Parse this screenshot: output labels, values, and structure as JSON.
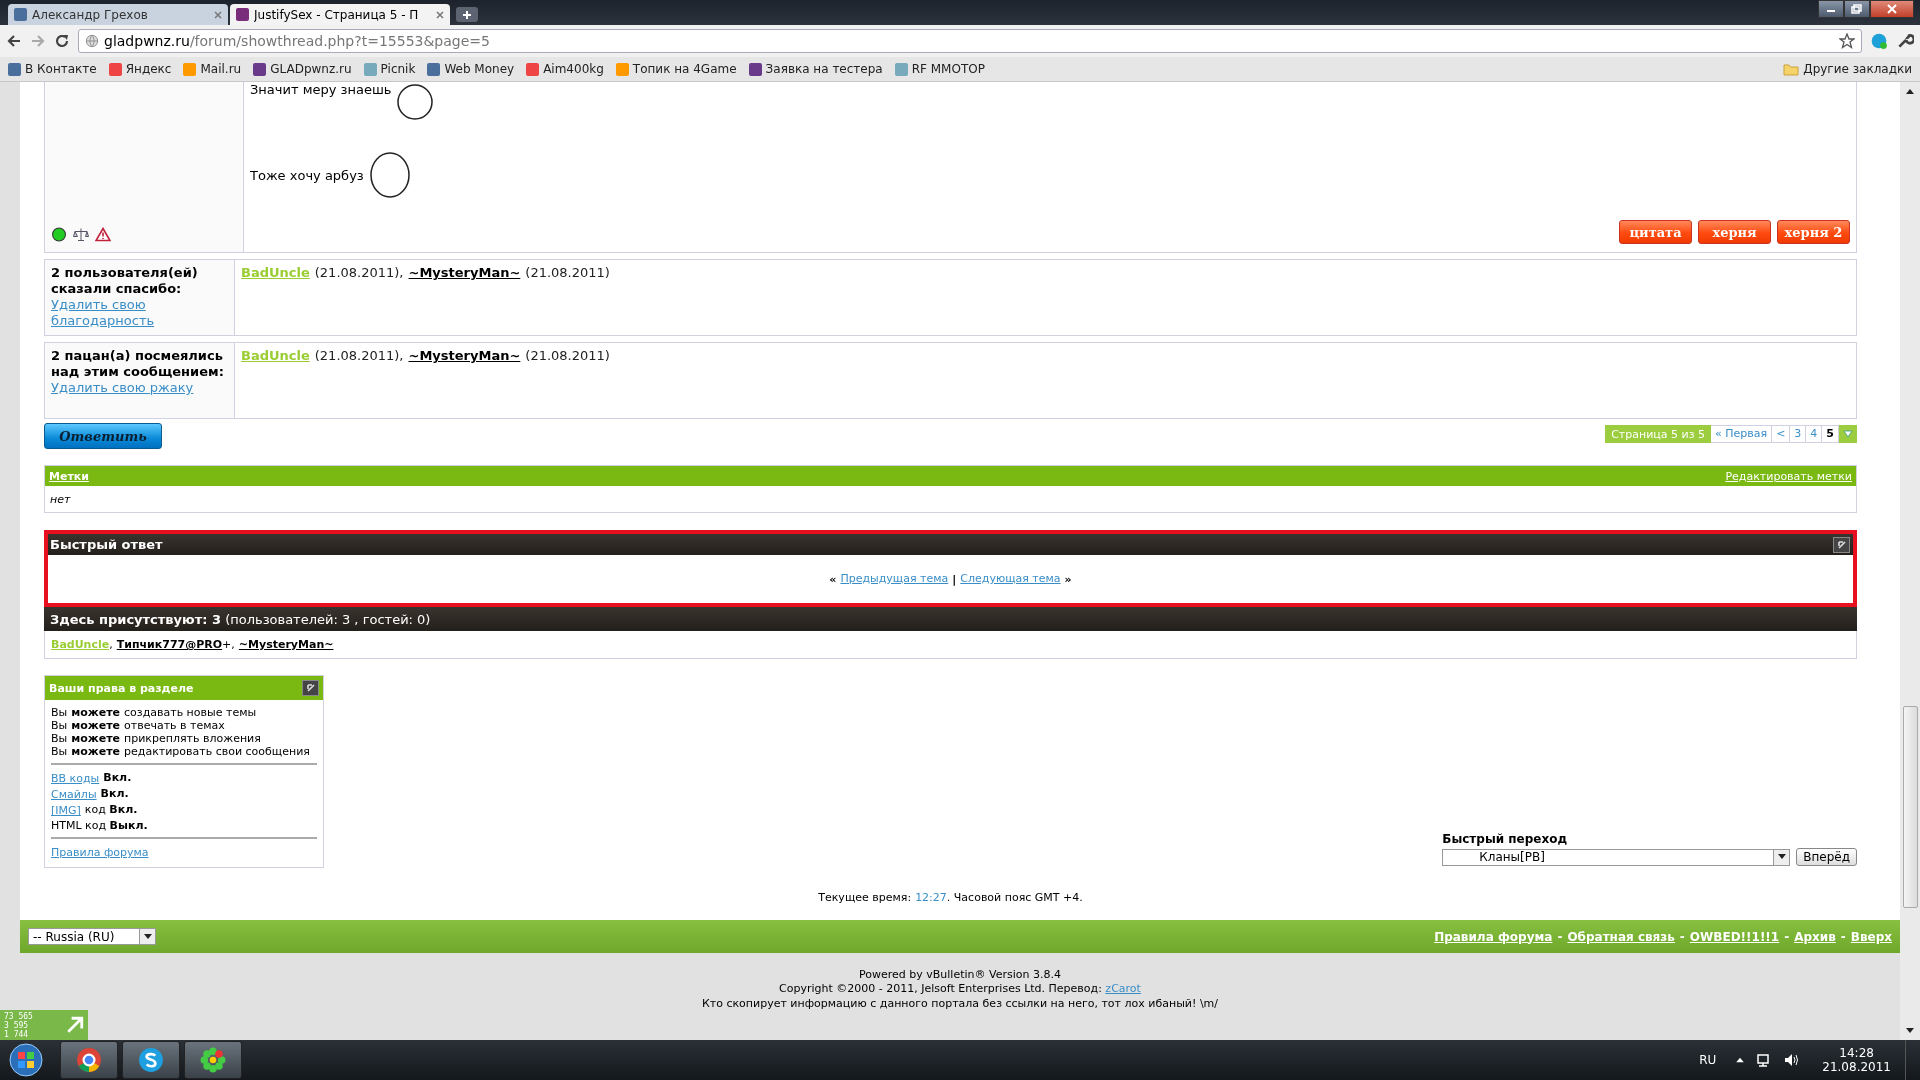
{
  "browser": {
    "tabs": [
      {
        "title": "Александр Грехов",
        "selected": false
      },
      {
        "title": "JustifySex - Страница 5 - П",
        "selected": true
      }
    ],
    "address": {
      "host": "gladpwnz.ru",
      "path": "/forum/showthread.php?t=15553&page=5"
    },
    "bookmarks": [
      "В Контакте",
      "Яндекс",
      "Mail.ru",
      "GLADpwnz.ru",
      "Picnik",
      "Web Money",
      "Aim400kg",
      "Топик на 4Game",
      "Заявка на тестера",
      "RF MMOTOP"
    ],
    "other_bookmarks": "Другие закладки"
  },
  "post": {
    "lines": [
      "Значит меру знаешь",
      "Тоже хочу арбуз"
    ],
    "buttons": [
      "цитата",
      "херня",
      "херня 2"
    ]
  },
  "feedback": [
    {
      "label": "2 пользователя(ей) сказали спасибо:",
      "link": "Удалить свою благодарность",
      "users": [
        {
          "name": "BadUncle",
          "date": "(21.08.2011),",
          "color": "#9acd32"
        },
        {
          "name": "~MysteryMan~",
          "date": "(21.08.2011)",
          "color": "#000000"
        }
      ]
    },
    {
      "label": "2 пацан(а) посмеялись над этим сообщением:",
      "link": "Удалить свою ржаку",
      "users": [
        {
          "name": "BadUncle",
          "date": "(21.08.2011),",
          "color": "#9acd32"
        },
        {
          "name": "~MysteryMan~",
          "date": "(21.08.2011)",
          "color": "#000000"
        }
      ]
    }
  ],
  "reply_button": "Ответить",
  "pagination": {
    "label": "Страница 5 из 5",
    "pages": [
      {
        "label": "« Первая",
        "selected": false
      },
      {
        "label": "<",
        "selected": false
      },
      {
        "label": "3",
        "selected": false
      },
      {
        "label": "4",
        "selected": false
      },
      {
        "label": "5",
        "selected": true
      }
    ]
  },
  "tags": {
    "title": "Метки",
    "edit": "Редактировать метки",
    "value": "нет"
  },
  "quick_reply": {
    "title": "Быстрый ответ",
    "prev_mark": "«",
    "prev": "Предыдущая тема",
    "divider": "|",
    "next": "Следующая тема",
    "next_mark": "»"
  },
  "present": {
    "title": "**Здесь присутствуют: 3** (пользователей: 3 , гостей: 0)",
    "users": [
      {
        "name": "BadUncle",
        "suffix": ",",
        "color": "#9acd32"
      },
      {
        "name": "Типчик777@PRO",
        "suffix": "+,",
        "color": "#000000"
      },
      {
        "name": "~MysteryMan~",
        "color": "#000000"
      }
    ]
  },
  "rights": {
    "title": "Ваши права в разделе",
    "permissions": [
      "Вы **можете** создавать новые темы",
      "Вы **можете** отвечать в темах",
      "Вы **можете** прикреплять вложения",
      "Вы **можете** редактировать свои сообщения"
    ],
    "settings": [
      {
        "link": "BB коды",
        "text": "**Вкл.**"
      },
      {
        "link": "Смайлы",
        "text": "**Вкл.**"
      },
      {
        "link": "[IMG]",
        "text": "код **Вкл.**"
      },
      {
        "text": "HTML код **Выкл.**"
      }
    ],
    "rules": "Правила форума"
  },
  "quick_jump": {
    "label": "Быстрый переход",
    "value": "Кланы[PB]",
    "button": "Вперёд"
  },
  "time": {
    "prefix": "Текущее время:",
    "value": "12:27",
    "suffix": ". Часовой пояс GMT +4."
  },
  "footer": {
    "language": "-- Russia (RU)",
    "separator": "-",
    "links": [
      "Правила форума",
      "Обратная связь",
      "OWBED!!1!!1",
      "Архив",
      "Вверх"
    ]
  },
  "copyright": {
    "powered": "Powered by vBulletin® Version 3.8.4",
    "line": "Copyright ©2000 - 2011, Jelsoft Enterprises Ltd. Перевод:",
    "translator": "zCarot",
    "notice": "Кто скопирует информацию с данного портала без ссылки на него, тот лох ибаный! \\m/"
  },
  "counter": [
    "73 565",
    "3 595",
    "1 744"
  ],
  "taskbar": {
    "language": "RU",
    "time": "14:28",
    "date": "21.08.2011"
  }
}
